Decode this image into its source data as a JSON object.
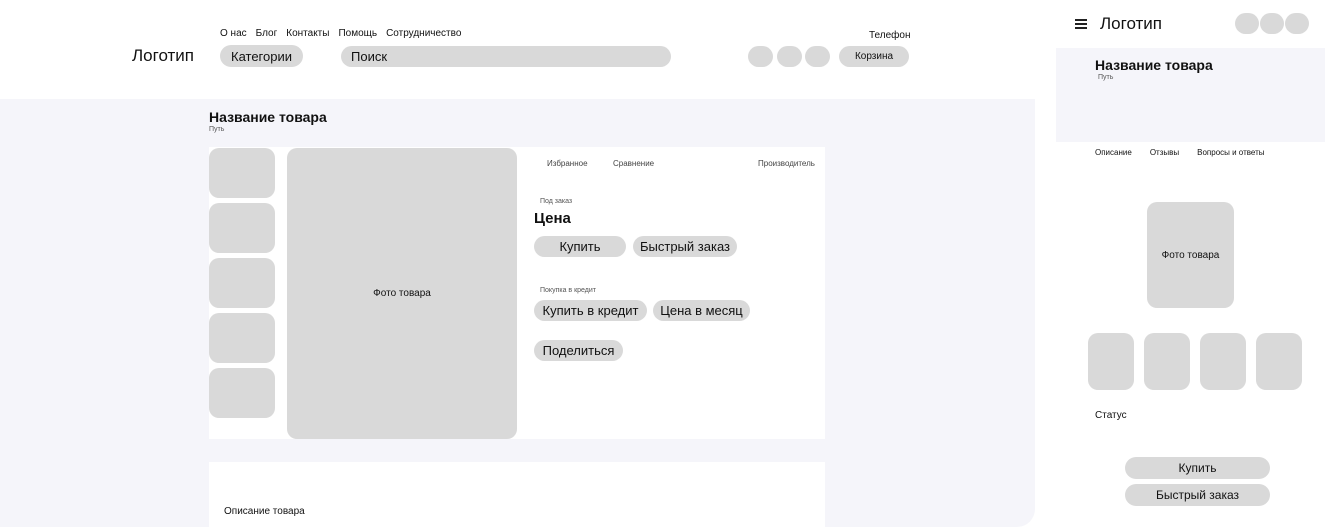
{
  "desktop": {
    "header": {
      "logo": "Логотип",
      "nav": [
        "О нас",
        "Блог",
        "Контакты",
        "Помощь",
        "Сотрудничество"
      ],
      "phone": "Телефон",
      "categories_label": "Категории",
      "search_placeholder": "Поиск",
      "cart_label": "Корзина"
    },
    "product": {
      "title": "Название товара",
      "path": "Путь",
      "photo_label": "Фото товара",
      "favorites": "Избранное",
      "compare": "Сравнение",
      "manufacturer": "Производитель",
      "availability": "Под заказ",
      "price": "Цена",
      "buy_label": "Купить",
      "quick_order_label": "Быстрый заказ",
      "credit_caption": "Покупка в кредит",
      "buy_credit_label": "Купить в кредит",
      "monthly_price_label": "Цена в месяц",
      "share_label": "Поделиться",
      "description_label": "Описание товара"
    }
  },
  "mobile": {
    "header": {
      "logo": "Логотип"
    },
    "product": {
      "title": "Название товара",
      "path": "Путь",
      "tabs": [
        "Описание",
        "Отзывы",
        "Вопросы и ответы"
      ],
      "photo_label": "Фото товара",
      "status": "Статус",
      "buy_label": "Купить",
      "quick_order_label": "Быстрый заказ"
    }
  },
  "icons": {
    "menu": "hamburger-menu-icon"
  },
  "colors": {
    "placeholder": "#d9d9d9",
    "content_background": "#f5f5fa"
  }
}
